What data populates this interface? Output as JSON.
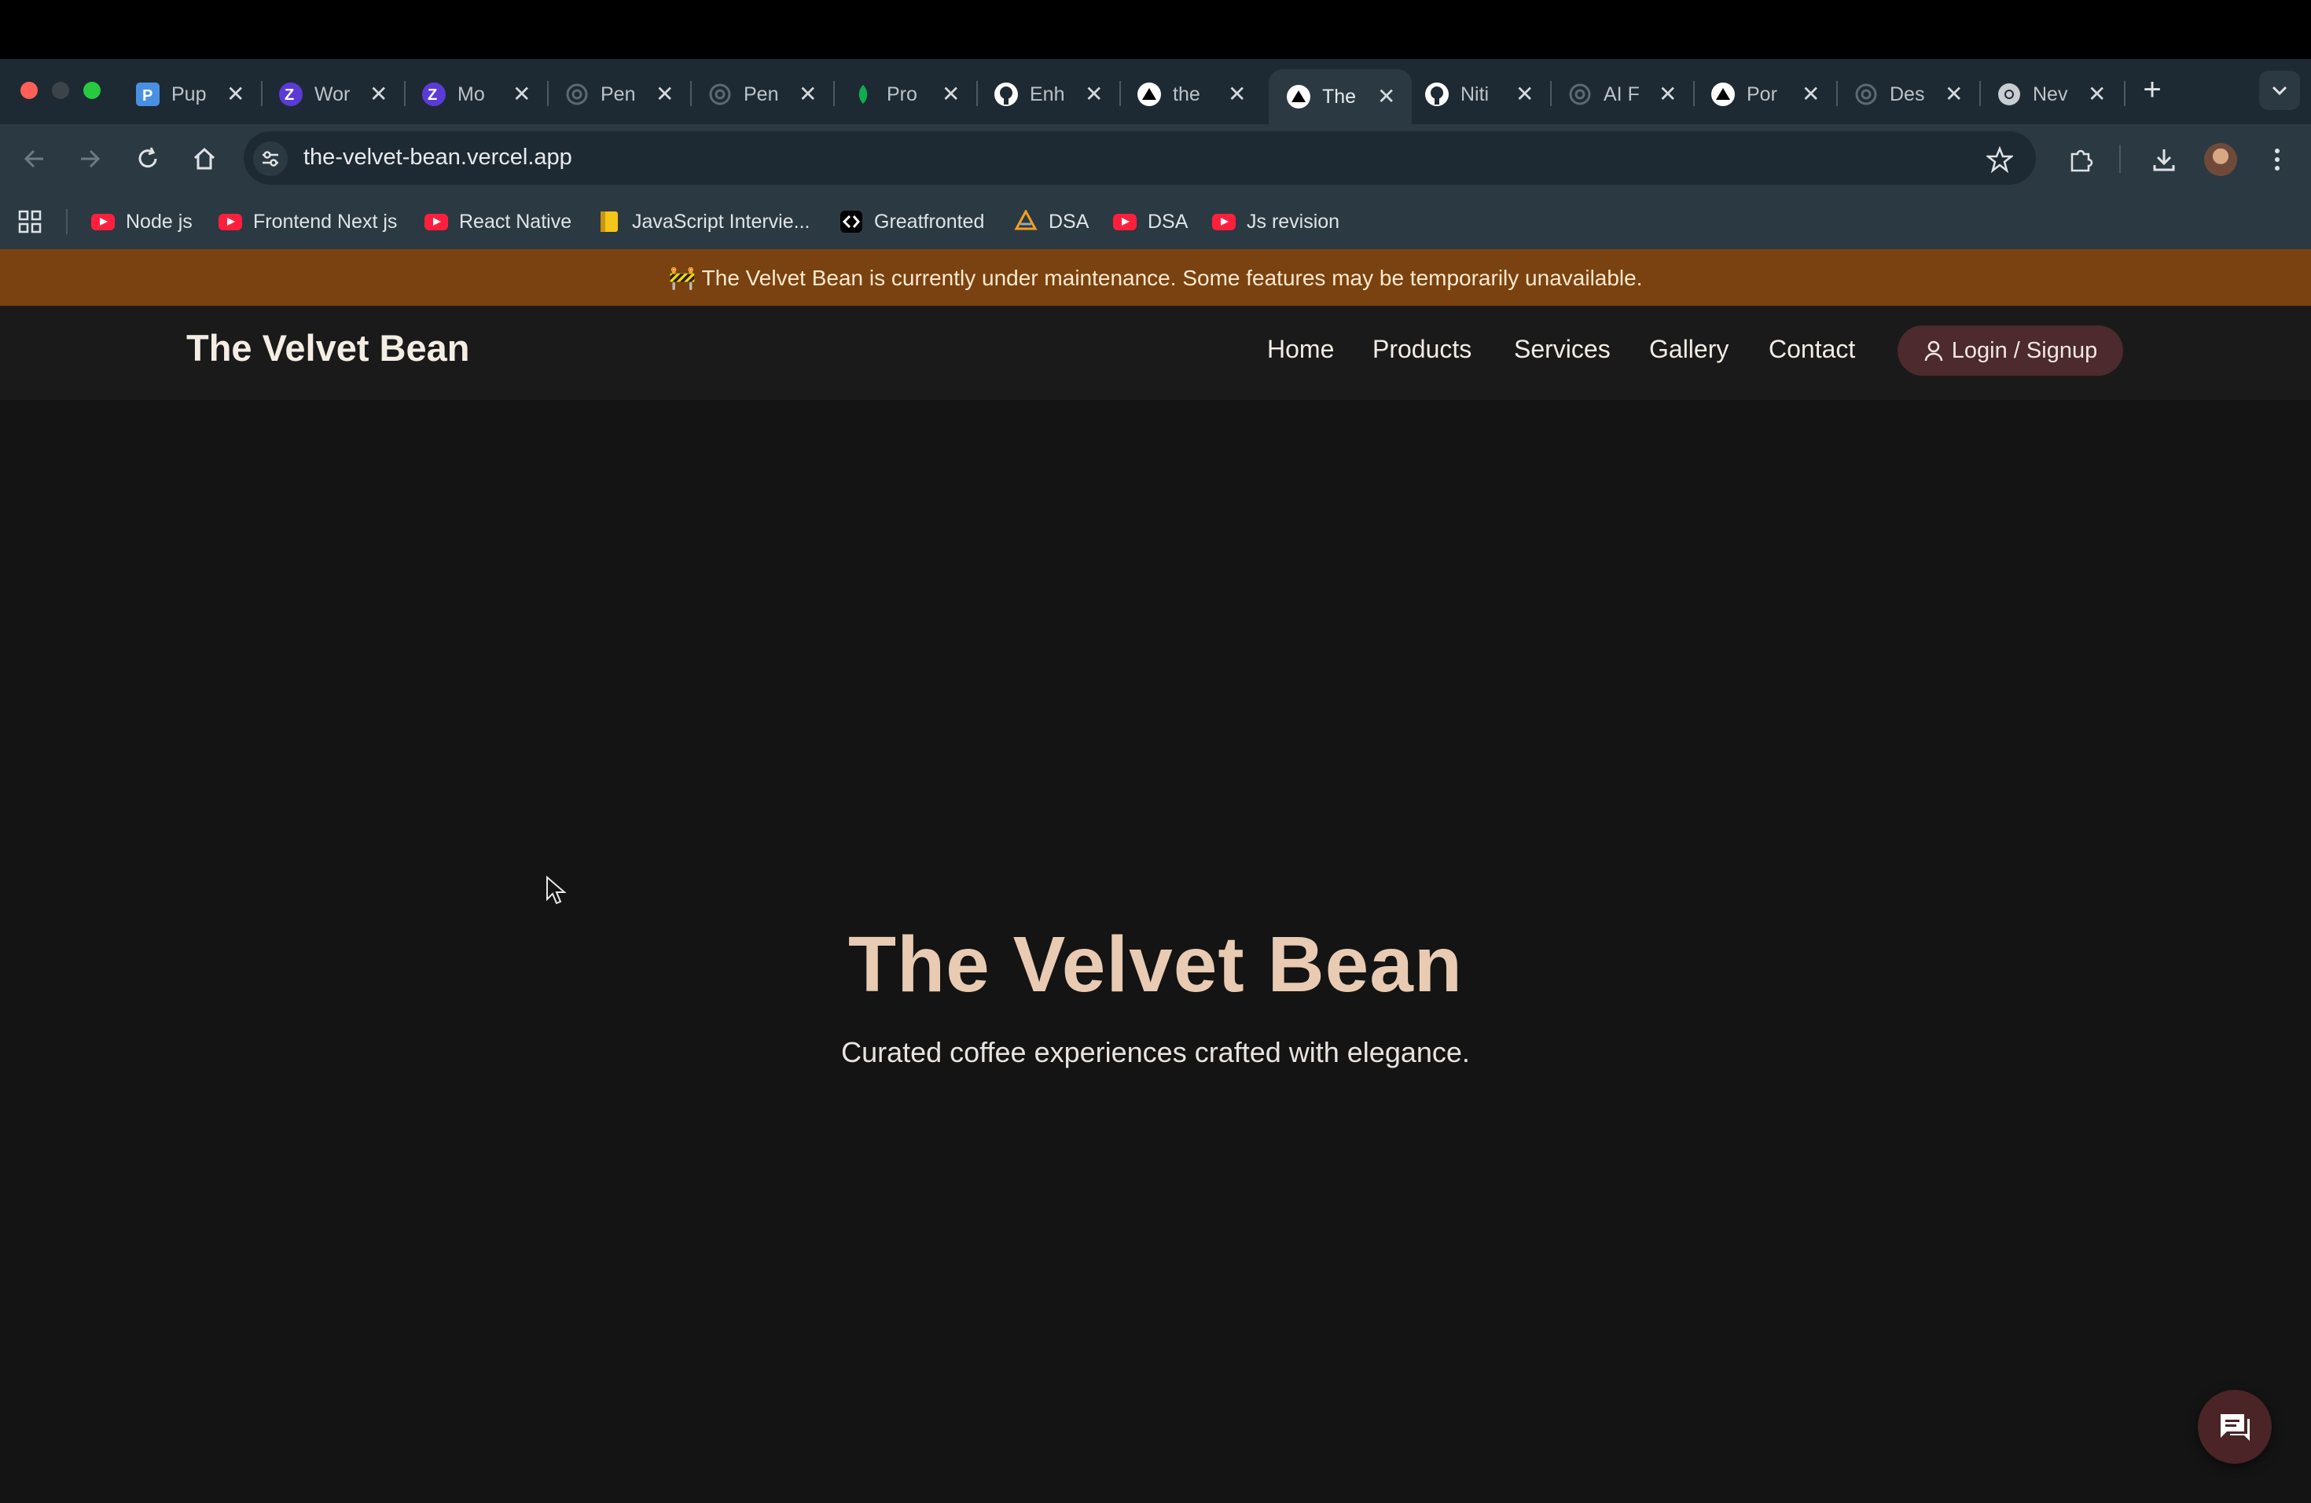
{
  "browser": {
    "tabs": [
      {
        "title": "Pup",
        "icon": "p-logo-icon"
      },
      {
        "title": "Wor",
        "icon": "z-logo-icon"
      },
      {
        "title": "Mo",
        "icon": "z-logo-icon"
      },
      {
        "title": "Pen",
        "icon": "openai-icon"
      },
      {
        "title": "Pen",
        "icon": "openai-icon"
      },
      {
        "title": "Pro",
        "icon": "leaf-icon"
      },
      {
        "title": "Enh",
        "icon": "github-icon"
      },
      {
        "title": "the",
        "icon": "vercel-icon"
      },
      {
        "title": "The",
        "icon": "vercel-icon",
        "active": true
      },
      {
        "title": "Niti",
        "icon": "github-icon"
      },
      {
        "title": "AI F",
        "icon": "openai-icon"
      },
      {
        "title": "Por",
        "icon": "vercel-icon"
      },
      {
        "title": "Des",
        "icon": "openai-icon"
      },
      {
        "title": "Nev",
        "icon": "chrome-icon"
      }
    ],
    "close_glyph": "✕",
    "new_tab_glyph": "+",
    "url": "the-velvet-bean.vercel.app",
    "bookmarks": [
      {
        "label": "Node js",
        "icon": "youtube-icon"
      },
      {
        "label": "Frontend Next js",
        "icon": "youtube-icon"
      },
      {
        "label": "React Native",
        "icon": "youtube-icon"
      },
      {
        "label": "JavaScript Intervie...",
        "icon": "notes-icon"
      },
      {
        "label": "Greatfronted",
        "icon": "greatfrontend-icon"
      },
      {
        "label": "DSA",
        "icon": "dsa-icon"
      },
      {
        "label": "DSA",
        "icon": "youtube-icon"
      },
      {
        "label": "Js revision",
        "icon": "youtube-icon"
      }
    ]
  },
  "site": {
    "banner": "🚧 The Velvet Bean is currently under maintenance. Some features may be temporarily unavailable.",
    "logo": "The Velvet Bean",
    "nav": {
      "home": "Home",
      "products": "Products",
      "services": "Services",
      "gallery": "Gallery",
      "contact": "Contact",
      "login": "Login / Signup"
    },
    "hero": {
      "title": "The Velvet Bean",
      "subtitle": "Curated coffee experiences crafted with elegance."
    }
  },
  "colors": {
    "banner_bg": "#7a4210",
    "hero_title": "#e8cbb2",
    "login_bg": "#4d2a2d",
    "page_bg": "#141414"
  }
}
